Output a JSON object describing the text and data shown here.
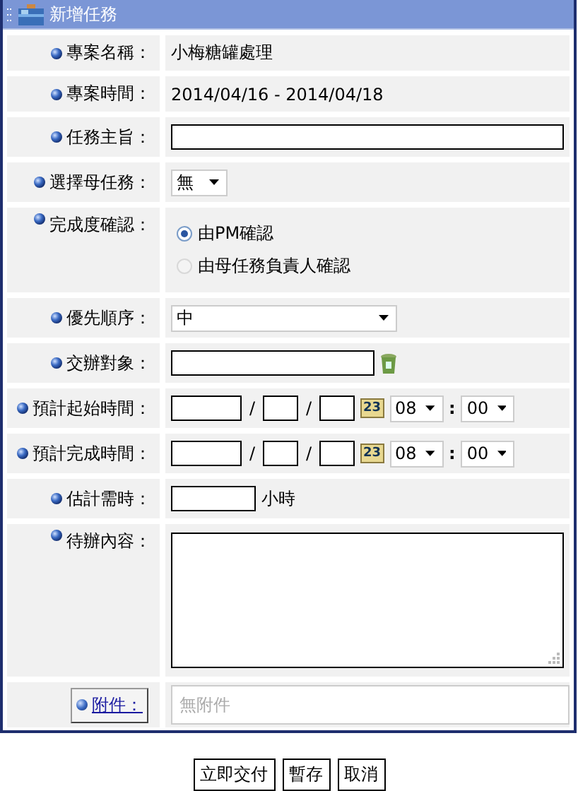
{
  "window": {
    "title": "新增任務"
  },
  "fields": [
    {
      "kind": "text",
      "label": "專案名稱：",
      "value": "小梅糖罐處理"
    },
    {
      "kind": "text",
      "label": "專案時間：",
      "value": "2014/04/16 - 2014/04/18"
    },
    {
      "kind": "input",
      "label": "任務主旨："
    },
    {
      "kind": "select",
      "label": "選擇母任務：",
      "value": "無"
    },
    {
      "kind": "radio",
      "label": "完成度確認：",
      "options": [
        {
          "label": "由PM確認",
          "selected": true
        },
        {
          "label": "由母任務負責人確認",
          "selected": false
        }
      ]
    },
    {
      "kind": "wideselect",
      "label": "優先順序：",
      "value": "中"
    },
    {
      "kind": "assignee",
      "label": "交辦對象："
    },
    {
      "kind": "datetime",
      "label": "預計起始時間：",
      "separators": [
        "/",
        "/",
        ":"
      ],
      "calendar": "23",
      "hour": "08",
      "minute": "00"
    },
    {
      "kind": "datetime",
      "label": "預計完成時間：",
      "separators": [
        "/",
        "/",
        ":"
      ],
      "calendar": "23",
      "hour": "08",
      "minute": "00"
    },
    {
      "kind": "hours",
      "label": "估計需時：",
      "unit": "小時"
    },
    {
      "kind": "textarea",
      "label": "待辦內容："
    },
    {
      "kind": "attachment",
      "label": "附件：",
      "placeholder": "無附件"
    }
  ],
  "buttons": [
    "立即交付",
    "暫存",
    "取消"
  ]
}
